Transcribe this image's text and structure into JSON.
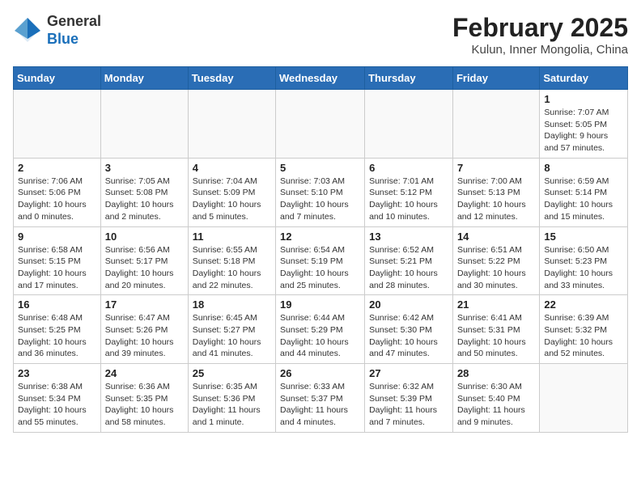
{
  "header": {
    "logo_general": "General",
    "logo_blue": "Blue",
    "month_year": "February 2025",
    "location": "Kulun, Inner Mongolia, China"
  },
  "days_of_week": [
    "Sunday",
    "Monday",
    "Tuesday",
    "Wednesday",
    "Thursday",
    "Friday",
    "Saturday"
  ],
  "weeks": [
    [
      {
        "day": "",
        "info": ""
      },
      {
        "day": "",
        "info": ""
      },
      {
        "day": "",
        "info": ""
      },
      {
        "day": "",
        "info": ""
      },
      {
        "day": "",
        "info": ""
      },
      {
        "day": "",
        "info": ""
      },
      {
        "day": "1",
        "info": "Sunrise: 7:07 AM\nSunset: 5:05 PM\nDaylight: 9 hours and 57 minutes."
      }
    ],
    [
      {
        "day": "2",
        "info": "Sunrise: 7:06 AM\nSunset: 5:06 PM\nDaylight: 10 hours and 0 minutes."
      },
      {
        "day": "3",
        "info": "Sunrise: 7:05 AM\nSunset: 5:08 PM\nDaylight: 10 hours and 2 minutes."
      },
      {
        "day": "4",
        "info": "Sunrise: 7:04 AM\nSunset: 5:09 PM\nDaylight: 10 hours and 5 minutes."
      },
      {
        "day": "5",
        "info": "Sunrise: 7:03 AM\nSunset: 5:10 PM\nDaylight: 10 hours and 7 minutes."
      },
      {
        "day": "6",
        "info": "Sunrise: 7:01 AM\nSunset: 5:12 PM\nDaylight: 10 hours and 10 minutes."
      },
      {
        "day": "7",
        "info": "Sunrise: 7:00 AM\nSunset: 5:13 PM\nDaylight: 10 hours and 12 minutes."
      },
      {
        "day": "8",
        "info": "Sunrise: 6:59 AM\nSunset: 5:14 PM\nDaylight: 10 hours and 15 minutes."
      }
    ],
    [
      {
        "day": "9",
        "info": "Sunrise: 6:58 AM\nSunset: 5:15 PM\nDaylight: 10 hours and 17 minutes."
      },
      {
        "day": "10",
        "info": "Sunrise: 6:56 AM\nSunset: 5:17 PM\nDaylight: 10 hours and 20 minutes."
      },
      {
        "day": "11",
        "info": "Sunrise: 6:55 AM\nSunset: 5:18 PM\nDaylight: 10 hours and 22 minutes."
      },
      {
        "day": "12",
        "info": "Sunrise: 6:54 AM\nSunset: 5:19 PM\nDaylight: 10 hours and 25 minutes."
      },
      {
        "day": "13",
        "info": "Sunrise: 6:52 AM\nSunset: 5:21 PM\nDaylight: 10 hours and 28 minutes."
      },
      {
        "day": "14",
        "info": "Sunrise: 6:51 AM\nSunset: 5:22 PM\nDaylight: 10 hours and 30 minutes."
      },
      {
        "day": "15",
        "info": "Sunrise: 6:50 AM\nSunset: 5:23 PM\nDaylight: 10 hours and 33 minutes."
      }
    ],
    [
      {
        "day": "16",
        "info": "Sunrise: 6:48 AM\nSunset: 5:25 PM\nDaylight: 10 hours and 36 minutes."
      },
      {
        "day": "17",
        "info": "Sunrise: 6:47 AM\nSunset: 5:26 PM\nDaylight: 10 hours and 39 minutes."
      },
      {
        "day": "18",
        "info": "Sunrise: 6:45 AM\nSunset: 5:27 PM\nDaylight: 10 hours and 41 minutes."
      },
      {
        "day": "19",
        "info": "Sunrise: 6:44 AM\nSunset: 5:29 PM\nDaylight: 10 hours and 44 minutes."
      },
      {
        "day": "20",
        "info": "Sunrise: 6:42 AM\nSunset: 5:30 PM\nDaylight: 10 hours and 47 minutes."
      },
      {
        "day": "21",
        "info": "Sunrise: 6:41 AM\nSunset: 5:31 PM\nDaylight: 10 hours and 50 minutes."
      },
      {
        "day": "22",
        "info": "Sunrise: 6:39 AM\nSunset: 5:32 PM\nDaylight: 10 hours and 52 minutes."
      }
    ],
    [
      {
        "day": "23",
        "info": "Sunrise: 6:38 AM\nSunset: 5:34 PM\nDaylight: 10 hours and 55 minutes."
      },
      {
        "day": "24",
        "info": "Sunrise: 6:36 AM\nSunset: 5:35 PM\nDaylight: 10 hours and 58 minutes."
      },
      {
        "day": "25",
        "info": "Sunrise: 6:35 AM\nSunset: 5:36 PM\nDaylight: 11 hours and 1 minute."
      },
      {
        "day": "26",
        "info": "Sunrise: 6:33 AM\nSunset: 5:37 PM\nDaylight: 11 hours and 4 minutes."
      },
      {
        "day": "27",
        "info": "Sunrise: 6:32 AM\nSunset: 5:39 PM\nDaylight: 11 hours and 7 minutes."
      },
      {
        "day": "28",
        "info": "Sunrise: 6:30 AM\nSunset: 5:40 PM\nDaylight: 11 hours and 9 minutes."
      },
      {
        "day": "",
        "info": ""
      }
    ]
  ]
}
